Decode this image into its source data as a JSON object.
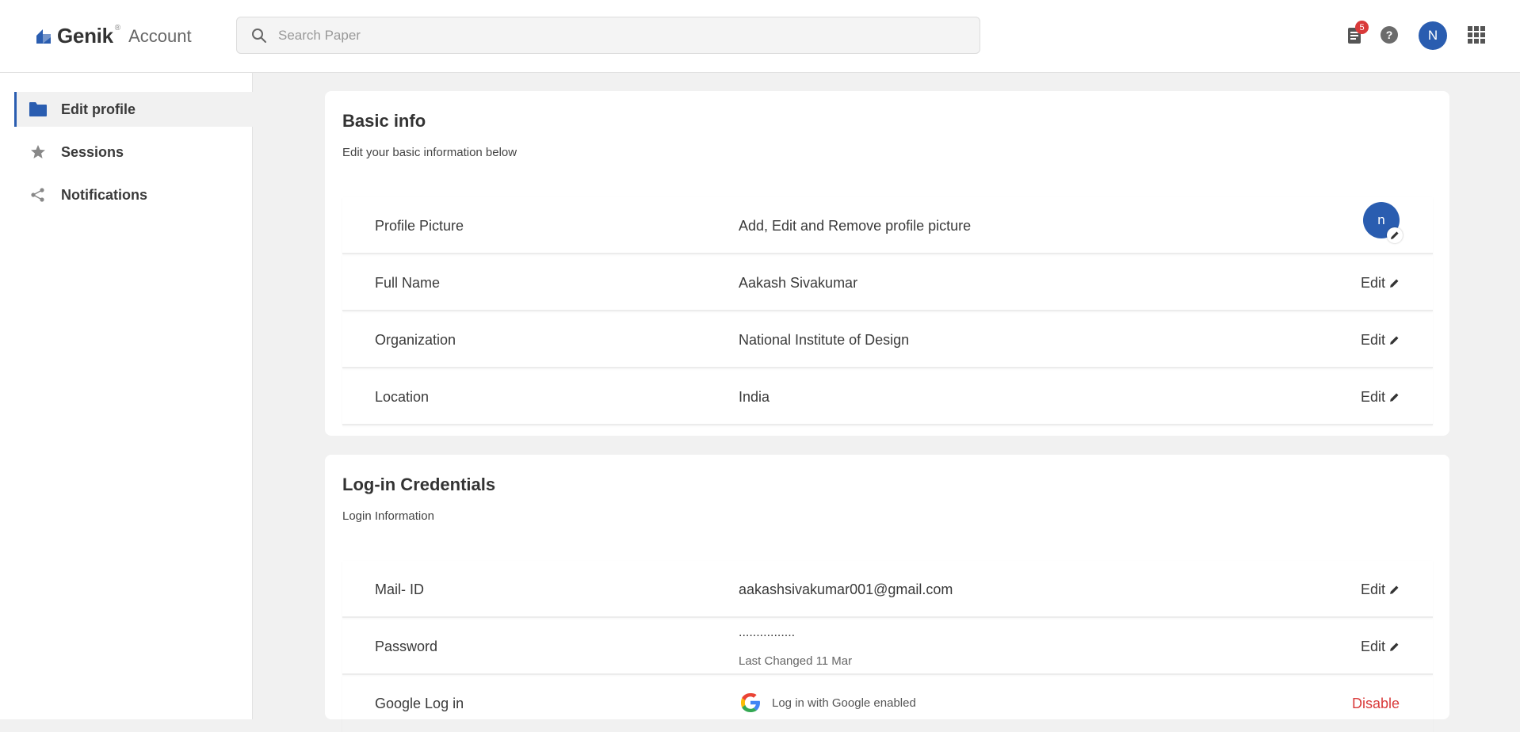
{
  "brand": {
    "name": "Genik",
    "reg": "®",
    "section": "Account"
  },
  "search": {
    "placeholder": "Search Paper",
    "value": ""
  },
  "header": {
    "notification_count": "5",
    "help_symbol": "?",
    "user_initial": "N"
  },
  "sidebar": {
    "items": [
      {
        "label": "Edit profile",
        "icon": "folder-icon",
        "active": true
      },
      {
        "label": "Sessions",
        "icon": "star-icon",
        "active": false
      },
      {
        "label": "Notifications",
        "icon": "share-icon",
        "active": false
      }
    ]
  },
  "basic_info": {
    "title": "Basic info",
    "subtitle": "Edit your basic information below",
    "rows": [
      {
        "label": "Profile Picture",
        "value": "Add, Edit and Remove profile picture",
        "avatar_initial": "n"
      },
      {
        "label": "Full Name",
        "value": "Aakash Sivakumar",
        "action": "Edit"
      },
      {
        "label": "Organization",
        "value": "National Institute of Design",
        "action": "Edit"
      },
      {
        "label": "Location",
        "value": "India",
        "action": "Edit"
      }
    ]
  },
  "credentials": {
    "title": "Log-in Credentials",
    "subtitle": "Login Information",
    "rows": [
      {
        "label": "Mail- ID",
        "value": "aakashsivakumar001@gmail.com",
        "action": "Edit"
      },
      {
        "label": "Password",
        "value": "................",
        "sub": "Last Changed 11 Mar",
        "action": "Edit"
      },
      {
        "label": "Google Log in",
        "value": "Log in with Google enabled",
        "action": "Disable"
      }
    ]
  },
  "colors": {
    "accent": "#2a5db0",
    "danger": "#d93a3a",
    "background": "#f1f1f1"
  }
}
